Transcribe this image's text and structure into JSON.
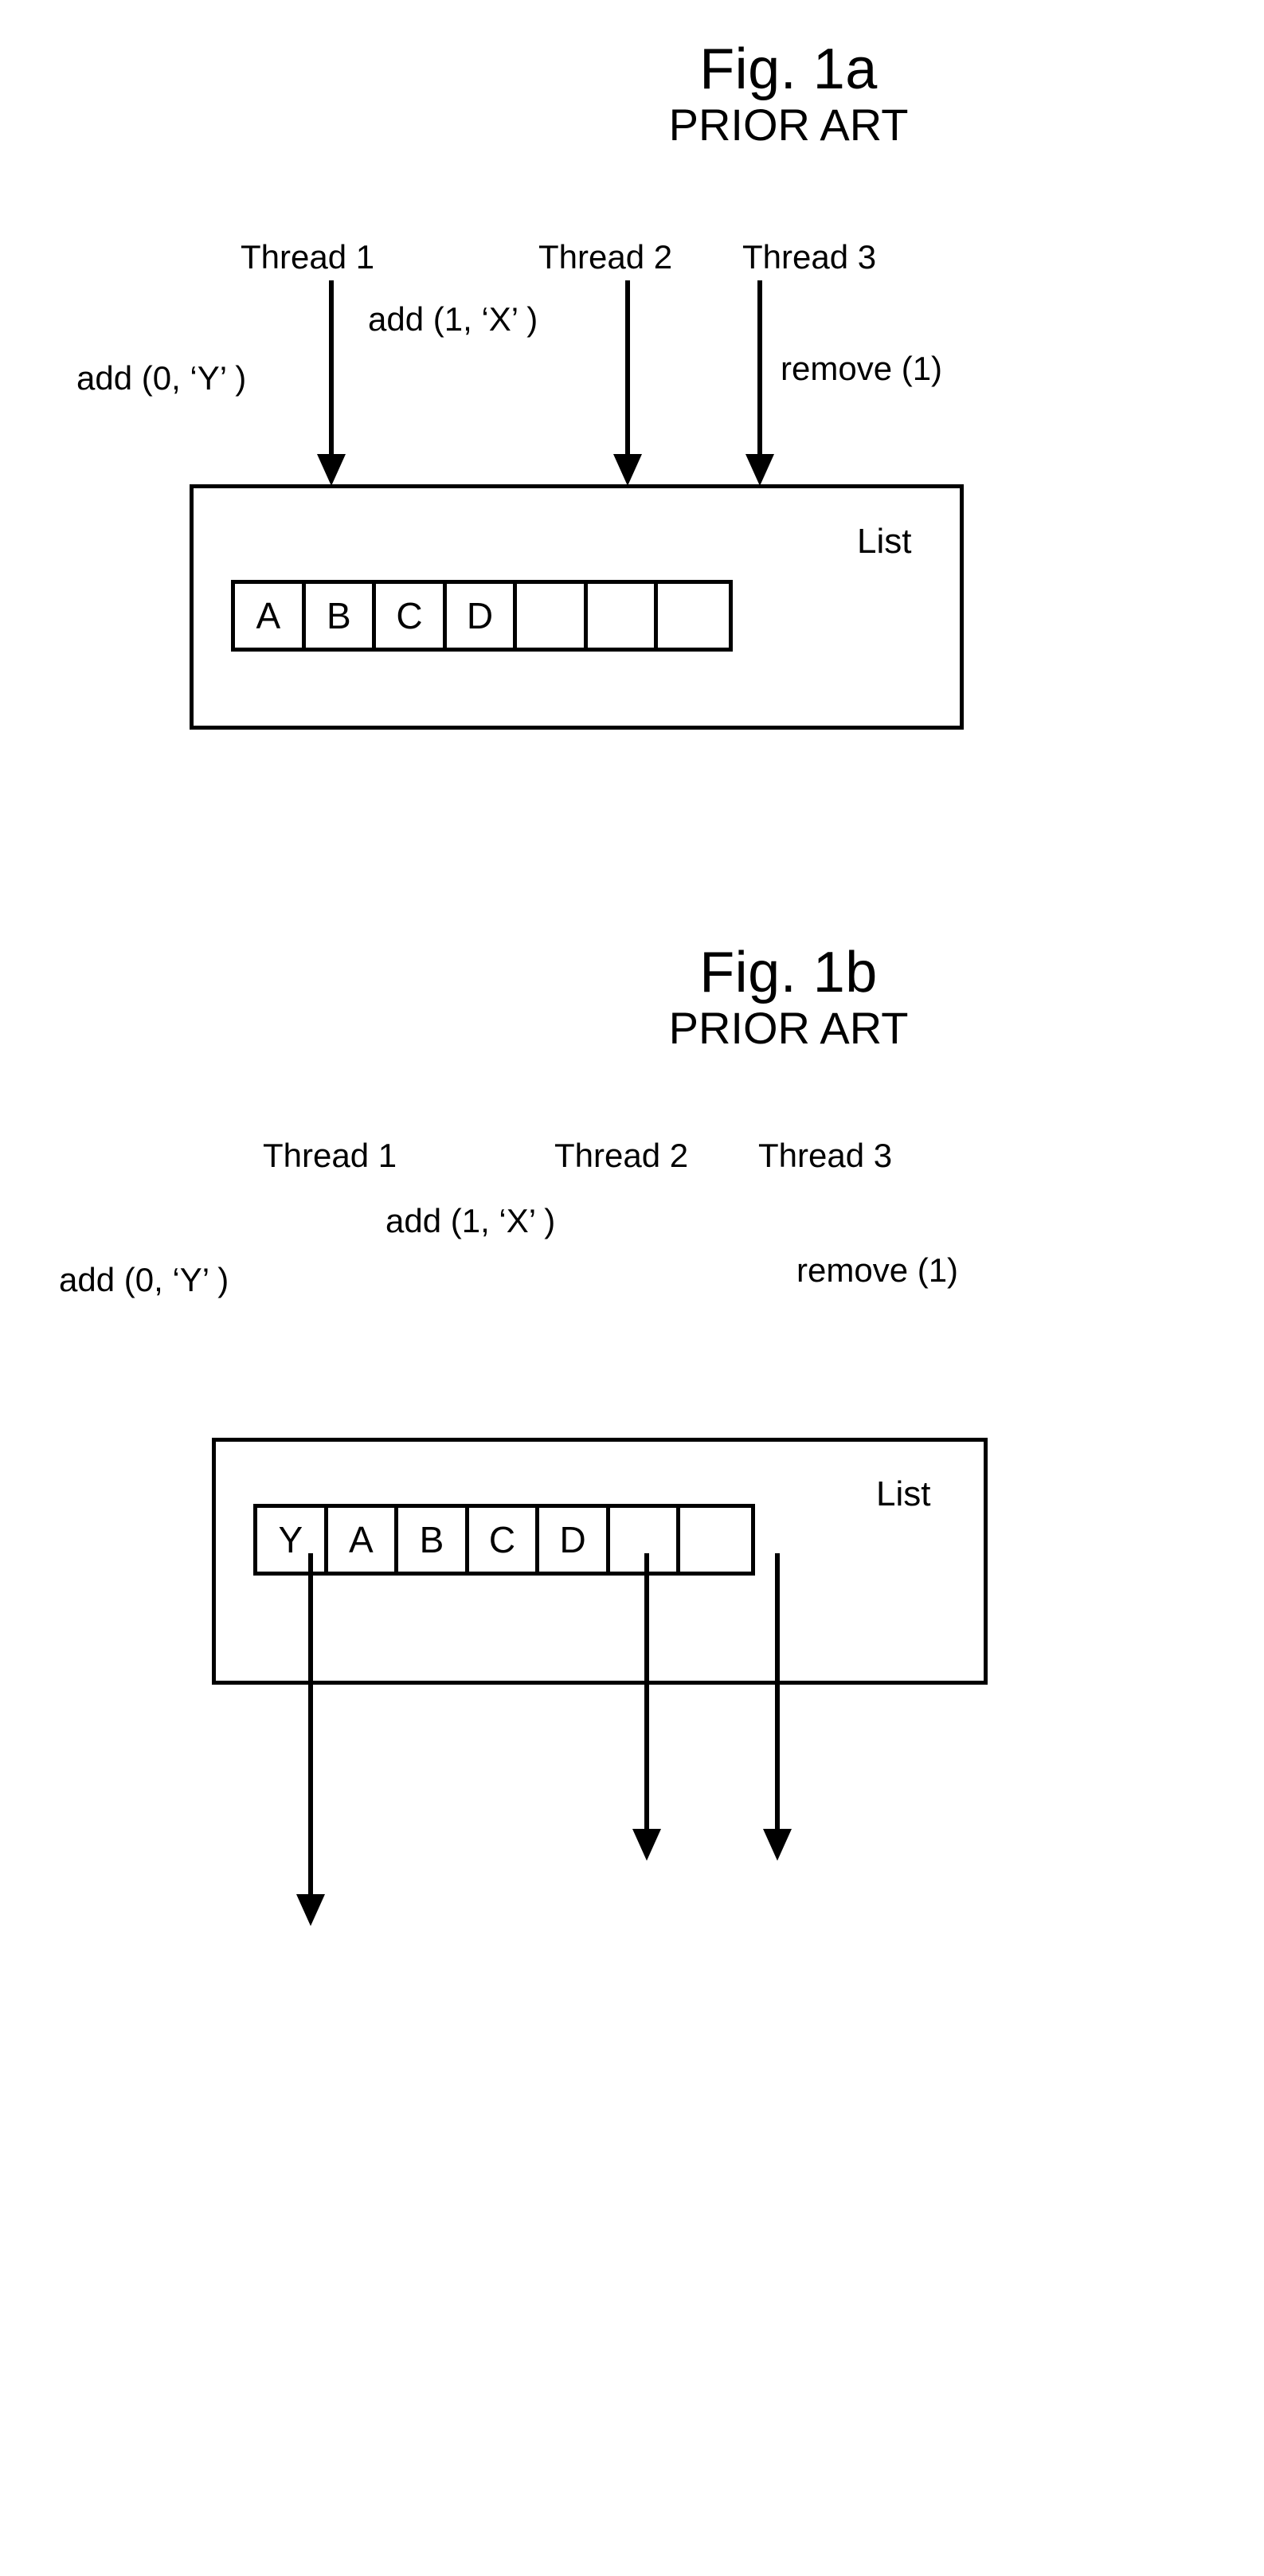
{
  "figures": [
    {
      "id": "fig-1a",
      "title_number": "Fig. 1a",
      "title_prior_art": "PRIOR ART",
      "threads": [
        {
          "label": "Thread 1",
          "operation": "add (0,  ‘Y’ )"
        },
        {
          "label": "Thread 2",
          "operation": "add (1,  ‘X’ )"
        },
        {
          "label": "Thread 3",
          "operation": "remove (1)"
        }
      ],
      "list_label": "List",
      "cells": [
        "A",
        "B",
        "C",
        "D",
        "",
        "",
        ""
      ]
    },
    {
      "id": "fig-1b",
      "title_number": "Fig. 1b",
      "title_prior_art": "PRIOR ART",
      "threads": [
        {
          "label": "Thread 1",
          "operation": "add (0,  ‘Y’ )"
        },
        {
          "label": "Thread 2",
          "operation": "add (1,  ‘X’ )"
        },
        {
          "label": "Thread 3",
          "operation": "remove (1)"
        }
      ],
      "list_label": "List",
      "cells": [
        "Y",
        "A",
        "B",
        "C",
        "D",
        "",
        ""
      ]
    }
  ],
  "colors": {
    "ink": "#000000",
    "paper": "#ffffff"
  }
}
